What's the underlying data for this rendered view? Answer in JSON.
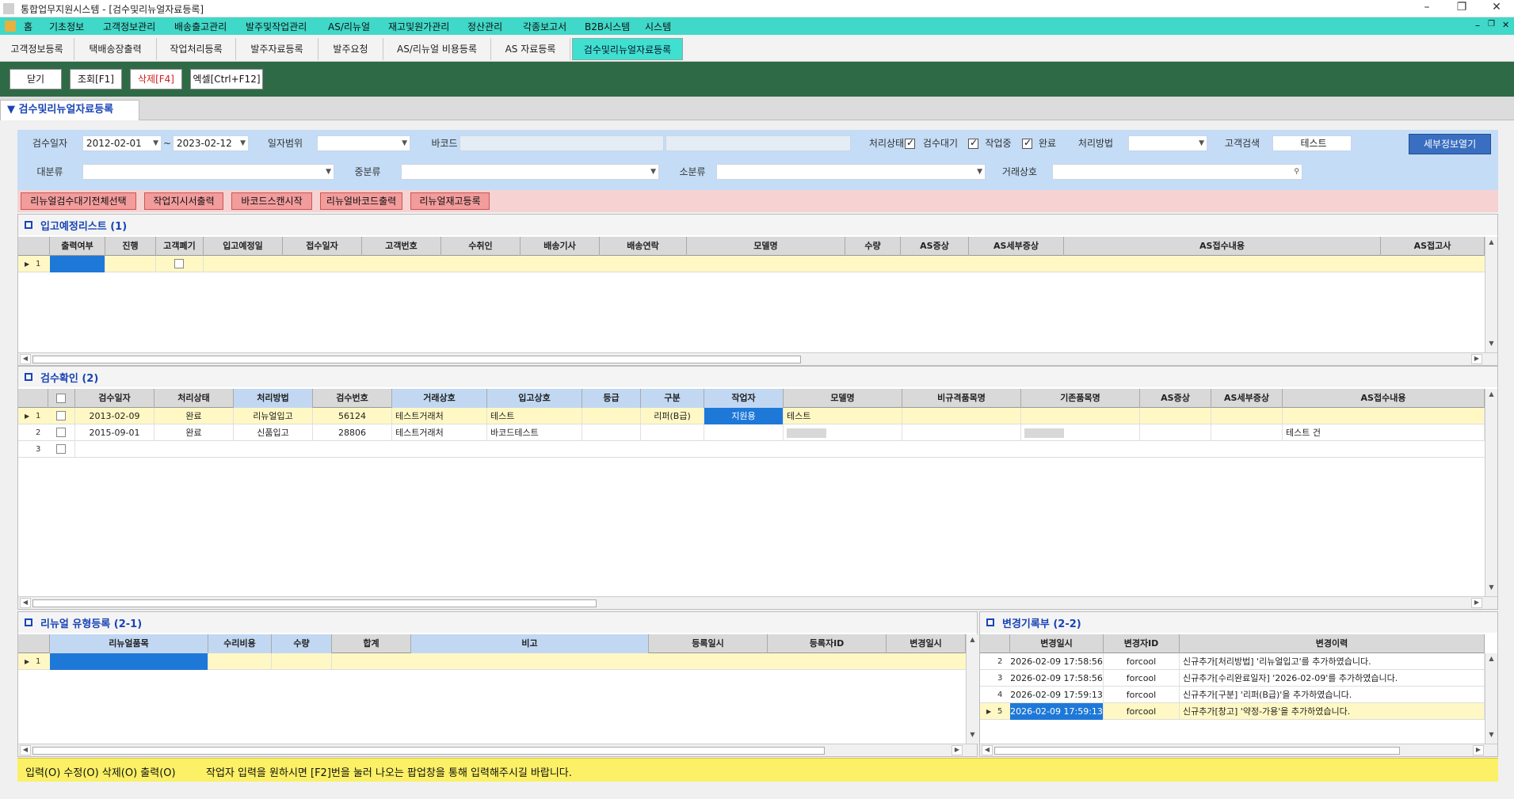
{
  "window": {
    "title": "통합업무지원시스템 - [검수및리뉴얼자료등록]"
  },
  "menubar": {
    "items": [
      "홈",
      "기초정보",
      "고객정보관리",
      "배송출고관리",
      "발주및작업관리",
      "AS/리뉴얼",
      "재고및원가관리",
      "정산관리",
      "각종보고서",
      "B2B시스템",
      "시스템"
    ]
  },
  "tabs": [
    "고객정보등록",
    "택배송장출력",
    "작업처리등록",
    "발주자료등록",
    "발주요청",
    "AS/리뉴얼 비용등록",
    "AS 자료등록",
    "검수및리뉴얼자료등록"
  ],
  "toolbar": {
    "close": "닫기",
    "search": "조회[F1]",
    "delete": "삭제[F4]",
    "excel": "엑셀[Ctrl+F12]"
  },
  "page_title": "검수및리뉴얼자료등록",
  "filter": {
    "inspect_date_label": "검수일자",
    "date_from": "2012-02-01",
    "tilde": "~",
    "date_to": "2023-02-12",
    "date_range_label": "일자범위",
    "date_range_value": "",
    "barcode_label": "바코드",
    "barcode_value": "",
    "status_label": "처리상태",
    "chk_wait": "검수대기",
    "chk_working": "작업중",
    "chk_done": "완료",
    "method_label": "처리방법",
    "method_value": "",
    "customer_search_label": "고객검색",
    "customer_search_value": "테스트",
    "detail_button": "세부정보열기",
    "major_label": "대분류",
    "mid_label": "중분류",
    "minor_label": "소분류",
    "vendor_label": "거래상호"
  },
  "actions": [
    "리뉴얼검수대기전체선택",
    "작업지시서출력",
    "바코드스캔시작",
    "리뉴얼바코드출력",
    "리뉴얼재고등록"
  ],
  "panel1": {
    "title": "입고예정리스트 (1)",
    "columns": [
      "출력여부",
      "진행",
      "고객폐기",
      "입고예정일",
      "접수일자",
      "고객번호",
      "수취인",
      "배송기사",
      "배송연락",
      "모델명",
      "수량",
      "AS증상",
      "AS세부증상",
      "AS접수내용",
      "AS접고사"
    ],
    "rows": [
      {
        "num": "1"
      }
    ]
  },
  "panel2": {
    "title": "검수확인 (2)",
    "columns": [
      "검수일자",
      "처리상태",
      "처리방법",
      "검수번호",
      "거래상호",
      "입고상호",
      "등급",
      "구분",
      "작업자",
      "모델명",
      "비규격품목명",
      "기존품목명",
      "AS증상",
      "AS세부증상",
      "AS접수내용"
    ],
    "rows": [
      {
        "num": "1",
        "date": "2013-02-09",
        "status": "완료",
        "method": "리뉴얼입고",
        "no": "56124",
        "vendor": "테스트거래처",
        "in": "테스트",
        "grade": "",
        "type": "리퍼(B급)",
        "worker": "지원용",
        "model": "테스트",
        "nonstd": "",
        "orig": "",
        "as": "",
        "asd": "",
        "asc": ""
      },
      {
        "num": "2",
        "date": "2015-09-01",
        "status": "완료",
        "method": "신품입고",
        "no": "28806",
        "vendor": "테스트거래처",
        "in": "바코드테스트",
        "grade": "",
        "type": "",
        "worker": "",
        "model": "",
        "nonstd": "",
        "orig": "",
        "as": "",
        "asd": "",
        "asc": "테스트 건"
      },
      {
        "num": "3",
        "date": "",
        "status": "",
        "method": "",
        "no": "",
        "vendor": "",
        "in": "",
        "grade": "",
        "type": "",
        "worker": "",
        "model": "",
        "nonstd": "",
        "orig": "",
        "as": "",
        "asd": "",
        "asc": ""
      }
    ]
  },
  "panel3": {
    "title": "리뉴얼 유형등록 (2-1)",
    "columns": [
      "리뉴얼품목",
      "수리비용",
      "수량",
      "합계",
      "비고",
      "등록일시",
      "등록자ID",
      "변경일시"
    ],
    "rows": [
      {
        "num": "1"
      }
    ]
  },
  "panel4": {
    "title": "변경기록부 (2-2)",
    "columns": [
      "변경일시",
      "변경자ID",
      "변경이력"
    ],
    "rows": [
      {
        "num": "2",
        "date": "2026-02-09 17:58:56",
        "user": "forcool",
        "log": "신규추가[처리방법] '리뉴얼입고'를 추가하였습니다."
      },
      {
        "num": "3",
        "date": "2026-02-09 17:58:56",
        "user": "forcool",
        "log": "신규추가[수리완료일자] '2026-02-09'를 추가하였습니다."
      },
      {
        "num": "4",
        "date": "2026-02-09 17:59:13",
        "user": "forcool",
        "log": "신규추가[구분] '리퍼(B급)'을 추가하였습니다."
      },
      {
        "num": "5",
        "date": "2026-02-09 17:59:13",
        "user": "forcool",
        "log": "신규추가[창고] '약정-가용'을 추가하였습니다."
      }
    ]
  },
  "status_bar": {
    "left": "입력(O) 수정(O) 삭제(O) 출력(O)",
    "message": "작업자 입력을 원하시면 [F2]번을 눌러 나오는 팝업창을 통해 입력해주시길 바랍니다."
  }
}
